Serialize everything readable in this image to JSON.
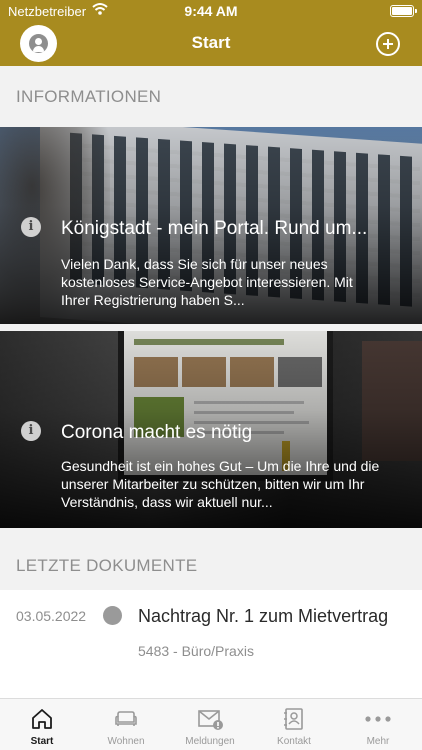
{
  "status_bar": {
    "carrier": "Netzbetreiber",
    "time": "9:44 AM"
  },
  "nav": {
    "title": "Start"
  },
  "sections": {
    "info_header": "INFORMATIONEN",
    "docs_header": "LETZTE DOKUMENTE"
  },
  "info_cards": [
    {
      "title": "Königstadt - mein Portal. Rund um...",
      "text": "Vielen Dank, dass Sie sich für unser neues kostenloses Service-Angebot interessieren. Mit Ihrer Registrierung haben S..."
    },
    {
      "title": "Corona macht es nötig",
      "text": "Gesundheit ist ein hohes Gut – Um die Ihre und die unserer Mitarbeiter zu schützen, bitten wir um Ihr Verständnis, dass wir aktuell nur..."
    }
  ],
  "documents": [
    {
      "date": "03.05.2022",
      "title": "Nachtrag Nr. 1 zum Mietvertrag",
      "subtitle": "5483 - Büro/Praxis"
    }
  ],
  "tabs": [
    {
      "label": "Start",
      "icon": "home-icon",
      "active": true
    },
    {
      "label": "Wohnen",
      "icon": "sofa-icon",
      "active": false
    },
    {
      "label": "Meldungen",
      "icon": "mail-alert-icon",
      "active": false
    },
    {
      "label": "Kontakt",
      "icon": "contact-book-icon",
      "active": false
    },
    {
      "label": "Mehr",
      "icon": "more-dots-icon",
      "active": false
    }
  ],
  "colors": {
    "brand": "#a88b1f",
    "background": "#f2f2f2"
  }
}
